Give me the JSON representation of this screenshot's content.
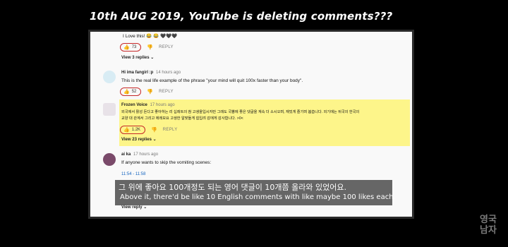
{
  "title": "10th AUG 2019, YouTube is deleting comments???",
  "comments": [
    {
      "author": "",
      "time": "",
      "text": "I  Love this! 😂 😂 🖤🖤🖤",
      "likes": "73",
      "reply_label": "REPLY",
      "view_replies": "View 3 replies"
    },
    {
      "author": "Hi ima fangirl :p",
      "time": "14 hours ago",
      "text": "This is the real life example of the phrase \"your mind will quit 100x faster than your body\".",
      "likes": "52",
      "reply_label": "REPLY",
      "view_replies": ""
    },
    {
      "author": "Frozen Voice",
      "time": "17 hours ago",
      "text_line1": "외국에서 활성 돈다고 좋아하는 리 십레트의 참 고생을입시자만 그래도 국뽕에 좋은 댓글을 계속 더 소시오며, 재밌게 즐기며 봅습니다. 외기에는 뒤국의 한국의",
      "text_line2": "교양 대 관계서 그리고 에레모요 고생한 알맞들게 힘입려 감에게 감사합니다. >0<",
      "likes": "1.2K",
      "reply_label": "REPLY",
      "view_replies": "View 23 replies"
    },
    {
      "author": "ai ka",
      "time": "17 hours ago",
      "text": "If anyone wants to skip the vomiting scenes:",
      "timestamp": "11:54 - 11:58",
      "view_replies": "View reply"
    }
  ],
  "subtitle": {
    "korean": "그 위에 좋아요 100개정도 되는 영어 댓글이 10개쯤 올라와 있었어요.",
    "english": "Above it, there'd be like 10 English comments with like maybe 100 likes each."
  },
  "watermark": "영국남자",
  "icons": {
    "like": "thumbs-up-icon",
    "dislike": "thumbs-down-icon",
    "chevron": "chevron-down-icon"
  },
  "colors": {
    "highlight": "#fdf58a",
    "circle": "#c62828",
    "link": "#1565c0"
  }
}
